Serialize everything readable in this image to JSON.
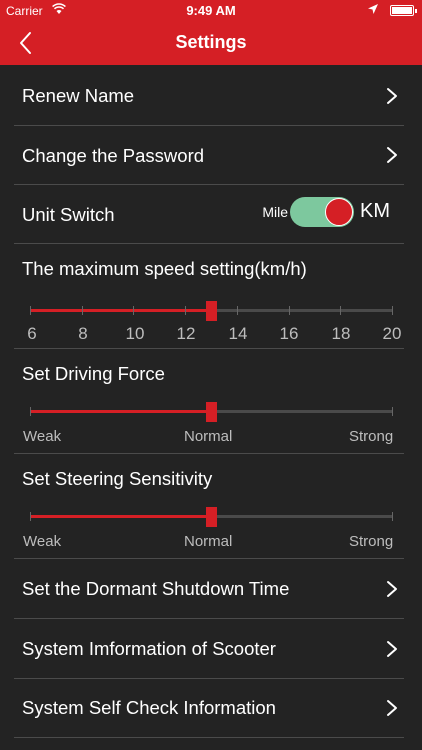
{
  "status_bar": {
    "carrier": "Carrier",
    "time": "9:49 AM"
  },
  "nav": {
    "title": "Settings",
    "back_icon": "chevron-left-icon"
  },
  "rows": {
    "renew_name": "Renew Name",
    "change_password": "Change the Password",
    "unit_switch": "Unit Switch",
    "dormant_shutdown": "Set the Dormant Shutdown Time",
    "system_information": "System Imformation of Scooter",
    "self_check": "System Self Check Information"
  },
  "unit_toggle": {
    "left_label": "Mile",
    "right_label": "KM",
    "selected": "KM"
  },
  "max_speed": {
    "label": "The maximum speed setting(km/h)",
    "scale": [
      "6",
      "8",
      "10",
      "12",
      "14",
      "16",
      "18",
      "20"
    ],
    "min": 6,
    "max": 20,
    "value": 13
  },
  "driving_force": {
    "label": "Set Driving Force",
    "levels": [
      "Weak",
      "Normal",
      "Strong"
    ],
    "value": 0.5
  },
  "steering": {
    "label": "Set Steering Sensitivity",
    "levels": [
      "Weak",
      "Normal",
      "Strong"
    ],
    "value": 0.5
  },
  "colors": {
    "accent": "#d51f25",
    "background": "#232323",
    "toggle_track": "#7dc89e"
  }
}
